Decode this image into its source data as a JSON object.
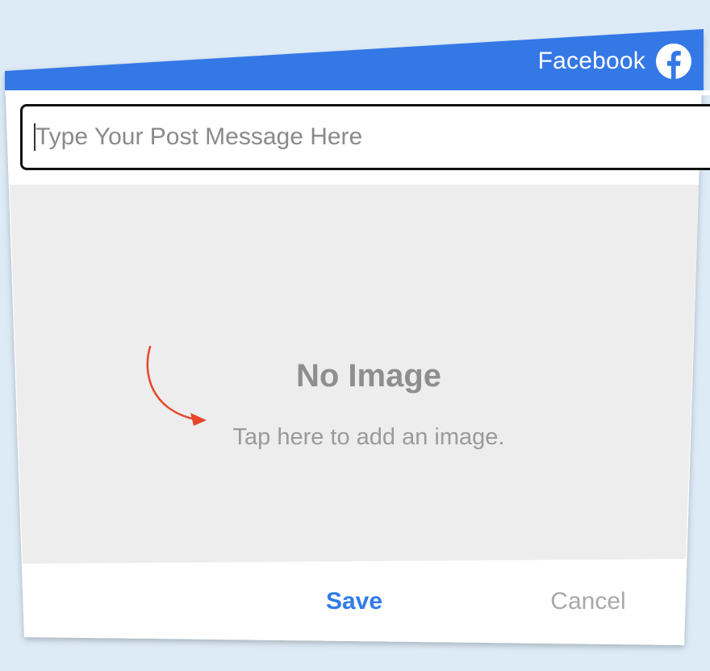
{
  "header": {
    "network_label": "Facebook",
    "network_icon": "facebook-icon",
    "accent_color": "#3478e6"
  },
  "post": {
    "placeholder": "Type Your Post Message Here",
    "value": ""
  },
  "image_picker": {
    "title": "No Image",
    "hint": "Tap here to add an image.",
    "hint_arrow_icon": "curved-arrow-icon",
    "arrow_color": "#e8452a"
  },
  "actions": {
    "save_label": "Save",
    "cancel_label": "Cancel",
    "save_color": "#2f7be8",
    "cancel_color": "#a8a8a8"
  }
}
